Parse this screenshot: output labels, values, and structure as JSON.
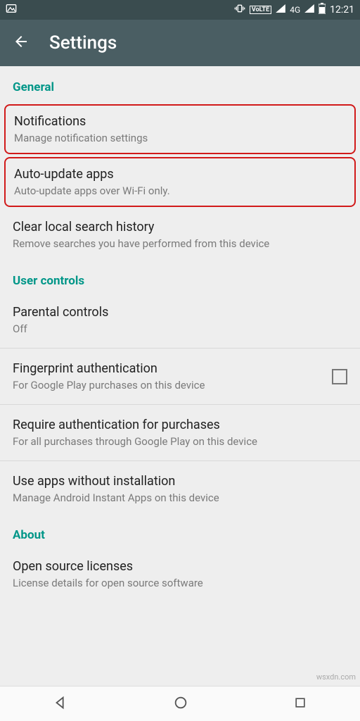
{
  "status": {
    "network_label": "4G",
    "time": "12:21",
    "volte": "VoLTE"
  },
  "header": {
    "title": "Settings"
  },
  "sections": {
    "general_label": "General",
    "user_controls_label": "User controls",
    "about_label": "About"
  },
  "items": {
    "notifications": {
      "title": "Notifications",
      "sub": "Manage notification settings"
    },
    "auto_update": {
      "title": "Auto-update apps",
      "sub": "Auto-update apps over Wi-Fi only."
    },
    "clear_history": {
      "title": "Clear local search history",
      "sub": "Remove searches you have performed from this device"
    },
    "parental": {
      "title": "Parental controls",
      "sub": "Off"
    },
    "fingerprint": {
      "title": "Fingerprint authentication",
      "sub": "For Google Play purchases on this device",
      "checked": false
    },
    "require_auth": {
      "title": "Require authentication for purchases",
      "sub": "For all purchases through Google Play on this device"
    },
    "instant_apps": {
      "title": "Use apps without installation",
      "sub": "Manage Android Instant Apps on this device"
    },
    "open_source": {
      "title": "Open source licenses",
      "sub": "License details for open source software"
    }
  },
  "watermark": "wsxdn.com"
}
